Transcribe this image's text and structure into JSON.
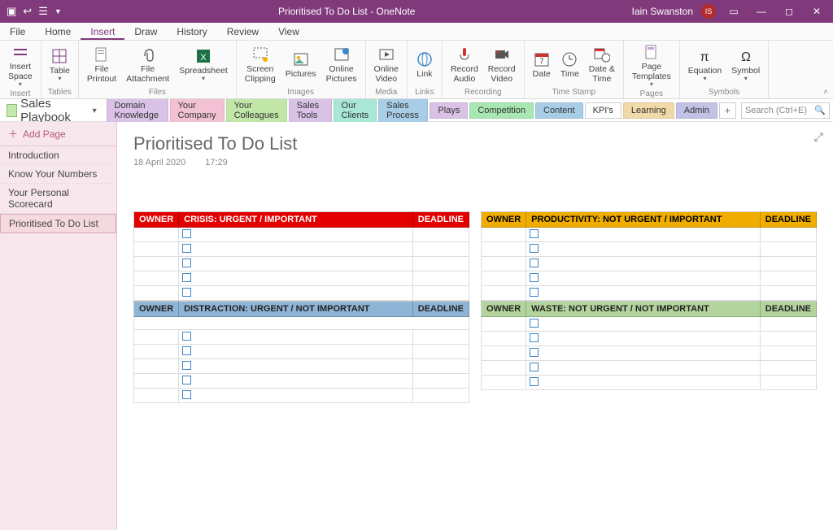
{
  "titlebar": {
    "title": "Prioritised To Do List  -  OneNote",
    "user": "Iain Swanston",
    "avatar": "IS"
  },
  "menu": {
    "tabs": [
      "File",
      "Home",
      "Insert",
      "Draw",
      "History",
      "Review",
      "View"
    ],
    "active": "Insert"
  },
  "ribbon": {
    "groups": [
      {
        "label": "Insert",
        "buttons": [
          {
            "l": "Insert\nSpace",
            "d": true
          }
        ]
      },
      {
        "label": "Tables",
        "buttons": [
          {
            "l": "Table",
            "d": true
          }
        ]
      },
      {
        "label": "Files",
        "buttons": [
          {
            "l": "File\nPrintout"
          },
          {
            "l": "File\nAttachment"
          },
          {
            "l": "Spreadsheet",
            "d": true
          }
        ]
      },
      {
        "label": "Images",
        "buttons": [
          {
            "l": "Screen\nClipping"
          },
          {
            "l": "Pictures"
          },
          {
            "l": "Online\nPictures"
          }
        ]
      },
      {
        "label": "Media",
        "buttons": [
          {
            "l": "Online\nVideo"
          }
        ]
      },
      {
        "label": "Links",
        "buttons": [
          {
            "l": "Link"
          }
        ]
      },
      {
        "label": "Recording",
        "buttons": [
          {
            "l": "Record\nAudio"
          },
          {
            "l": "Record\nVideo"
          }
        ]
      },
      {
        "label": "Time Stamp",
        "buttons": [
          {
            "l": "Date"
          },
          {
            "l": "Time"
          },
          {
            "l": "Date &\nTime"
          }
        ]
      },
      {
        "label": "Pages",
        "buttons": [
          {
            "l": "Page\nTemplates",
            "d": true
          }
        ]
      },
      {
        "label": "Symbols",
        "buttons": [
          {
            "l": "Equation",
            "d": true
          },
          {
            "l": "Symbol",
            "d": true
          }
        ]
      }
    ]
  },
  "notebook": {
    "name": "Sales Playbook",
    "sections": [
      {
        "label": "Domain Knowledge",
        "bg": "#d9c2e6"
      },
      {
        "label": "Your Company",
        "bg": "#f2c2d4"
      },
      {
        "label": "Your Colleagues",
        "bg": "#c2e6a8"
      },
      {
        "label": "Sales Tools",
        "bg": "#d9c2e6"
      },
      {
        "label": "Our Clients",
        "bg": "#a8e6d6"
      },
      {
        "label": "Sales Process",
        "bg": "#a8cde6"
      },
      {
        "label": "Plays",
        "bg": "#d9c2e6"
      },
      {
        "label": "Competition",
        "bg": "#a8e6b2"
      },
      {
        "label": "Content",
        "bg": "#a8cde6"
      },
      {
        "label": "KPI's",
        "bg": "#ffffff"
      },
      {
        "label": "Learning",
        "bg": "#f2d9a8"
      },
      {
        "label": "Admin",
        "bg": "#c2c2e6"
      }
    ],
    "active_section": "KPI's",
    "search_placeholder": "Search (Ctrl+E)"
  },
  "pages": {
    "add_label": "Add Page",
    "items": [
      "Introduction",
      "Know Your Numbers",
      "Your Personal Scorecard",
      "Prioritised To Do List"
    ],
    "active": "Prioritised To Do List"
  },
  "page": {
    "title": "Prioritised To Do List",
    "date": "18 April 2020",
    "time": "17:29"
  },
  "matrix": {
    "common": {
      "owner": "OWNER",
      "deadline": "DEADLINE",
      "rows": 5
    },
    "quads": [
      {
        "title": "CRISIS: URGENT / IMPORTANT",
        "rows": 5
      },
      {
        "title": "PRODUCTIVITY: NOT URGENT / IMPORTANT",
        "rows": 5
      },
      {
        "title": "DISTRACTION: URGENT / NOT IMPORTANT",
        "rows": 5,
        "extra_input": true
      },
      {
        "title": "WASTE: NOT URGENT / NOT IMPORTANT",
        "rows": 5
      }
    ]
  }
}
